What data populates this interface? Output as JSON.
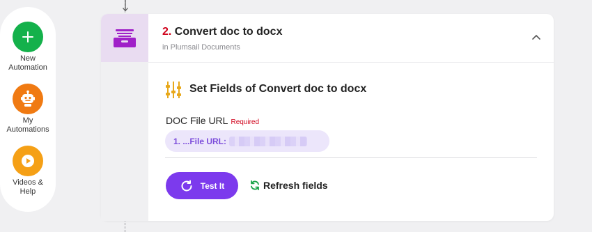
{
  "sidebar": {
    "items": [
      {
        "label": "New\nAutomation",
        "icon": "plus-icon",
        "color": "#14b14b"
      },
      {
        "label": "My\nAutomations",
        "icon": "robot-icon",
        "color": "#f07a12"
      },
      {
        "label": "Videos &\nHelp",
        "icon": "play-icon",
        "color": "#f5a016"
      }
    ]
  },
  "step": {
    "number": "2.",
    "title": "Convert doc to docx",
    "subtitle": "in Plumsail Documents",
    "icon": "archive-box-icon",
    "icon_color": "#a020c8",
    "icon_bg": "#e9dcf1"
  },
  "section": {
    "title": "Set Fields of Convert doc to docx",
    "icon": "sliders-icon",
    "icon_color": "#e8a81a"
  },
  "field": {
    "label": "DOC File URL",
    "required": "Required",
    "value": "1. ...File URL:"
  },
  "actions": {
    "test_label": "Test It",
    "refresh_label": "Refresh fields",
    "accent": "#7c3aed",
    "refresh_icon_color": "#1aa34a"
  }
}
